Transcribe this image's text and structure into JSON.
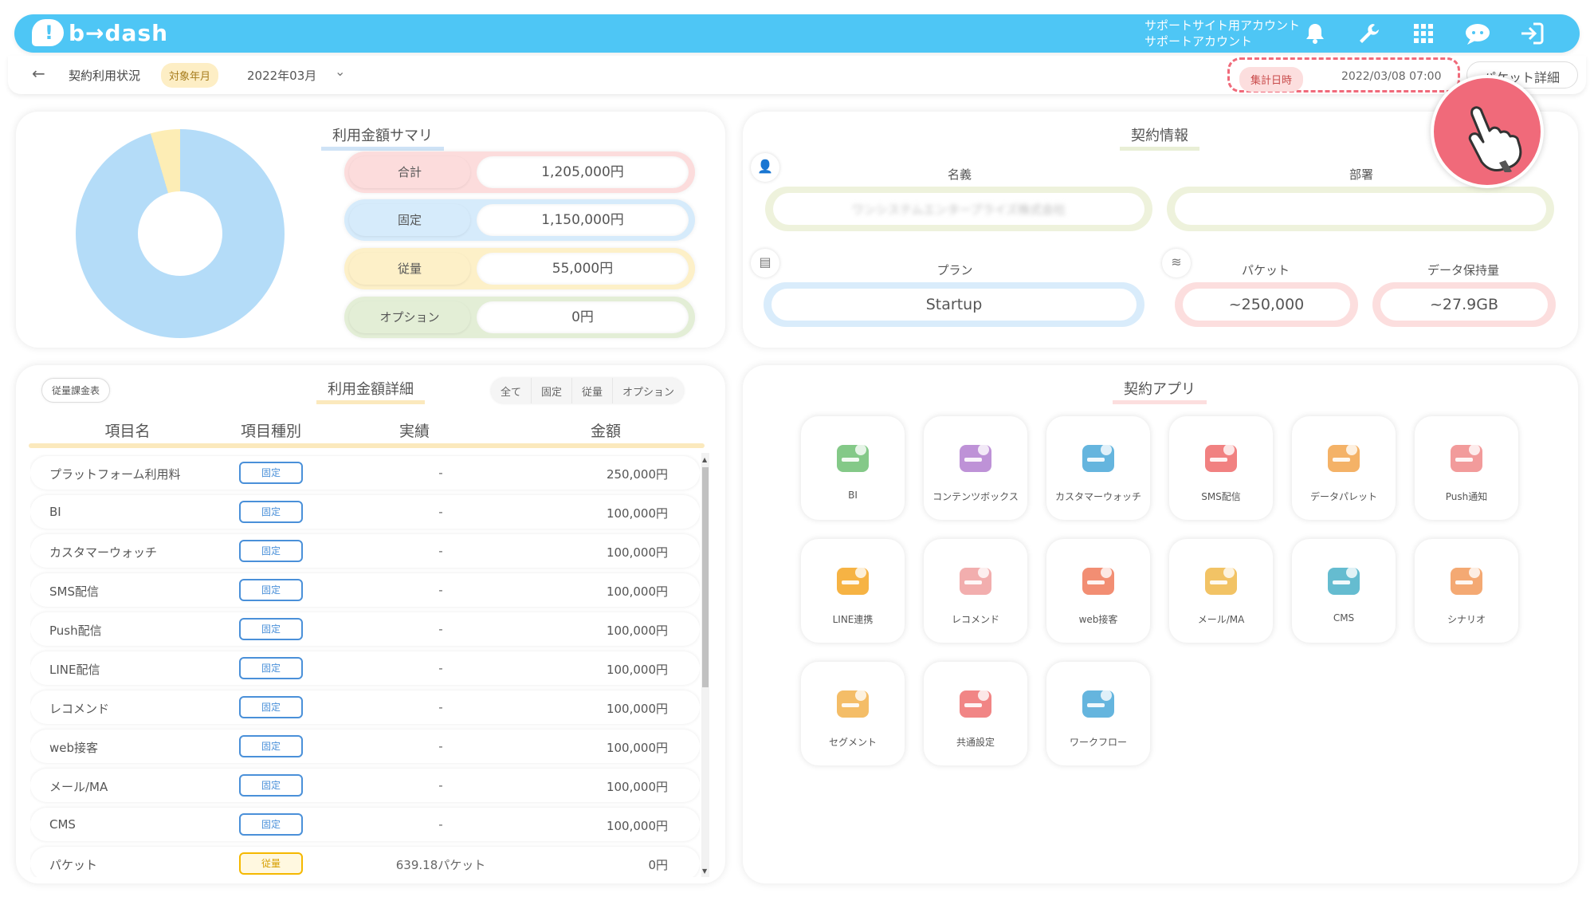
{
  "header": {
    "logo_text": "b→dash",
    "account_line1": "サポートサイト用アカウント",
    "account_line2": "サポートアカウント",
    "icons": [
      "bell-icon",
      "wrench-icon",
      "grid-icon",
      "chat-icon",
      "logout-icon"
    ]
  },
  "subbar": {
    "back_icon": "arrow-left-icon",
    "title": "契約利用状況",
    "period_tag": "対象年月",
    "month": "2022年03月",
    "aggregate_tag": "集計日時",
    "aggregate_time": "2022/03/08 07:00",
    "packet_detail": "パケット詳細"
  },
  "summary": {
    "title": "利用金額サマリ",
    "rows": [
      {
        "label": "合計",
        "value": "1,205,000円",
        "color": "#fcdcdc"
      },
      {
        "label": "固定",
        "value": "1,150,000円",
        "color": "#d6ebfb"
      },
      {
        "label": "従量",
        "value": "55,000円",
        "color": "#fdf0c8"
      },
      {
        "label": "オプション",
        "value": "0円",
        "color": "#e3eed6"
      }
    ],
    "donut_share": {
      "fixed": 1150000,
      "variable": 55000,
      "option": 0
    },
    "donut_colors": {
      "fixed": "#b4dcf8",
      "variable": "#fdedb5"
    }
  },
  "contract": {
    "title": "契約情報",
    "name_label": "名義",
    "name_value": "ワンシステムエンタープライズ株式会社",
    "dept_label": "部署",
    "dept_value": "",
    "plan_label": "プラン",
    "plan_value": "Startup",
    "packet_label": "パケット",
    "packet_value": "~250,000",
    "storage_label": "データ保持量",
    "storage_value": "~27.9GB"
  },
  "detail": {
    "title": "利用金額詳細",
    "chip": "従量課金表",
    "filters": [
      "全て",
      "固定",
      "従量",
      "オプション"
    ],
    "columns": [
      "項目名",
      "項目種別",
      "実績",
      "金額"
    ],
    "rows": [
      {
        "name": "プラットフォーム利用料",
        "type": "固定",
        "actual": "-",
        "amount": "250,000円"
      },
      {
        "name": "BI",
        "type": "固定",
        "actual": "-",
        "amount": "100,000円"
      },
      {
        "name": "カスタマーウォッチ",
        "type": "固定",
        "actual": "-",
        "amount": "100,000円"
      },
      {
        "name": "SMS配信",
        "type": "固定",
        "actual": "-",
        "amount": "100,000円"
      },
      {
        "name": "Push配信",
        "type": "固定",
        "actual": "-",
        "amount": "100,000円"
      },
      {
        "name": "LINE配信",
        "type": "固定",
        "actual": "-",
        "amount": "100,000円"
      },
      {
        "name": "レコメンド",
        "type": "固定",
        "actual": "-",
        "amount": "100,000円"
      },
      {
        "name": "web接客",
        "type": "固定",
        "actual": "-",
        "amount": "100,000円"
      },
      {
        "name": "メール/MA",
        "type": "固定",
        "actual": "-",
        "amount": "100,000円"
      },
      {
        "name": "CMS",
        "type": "固定",
        "actual": "-",
        "amount": "100,000円"
      },
      {
        "name": "パケット",
        "type": "従量",
        "actual": "639.18パケット",
        "amount": "0円"
      }
    ]
  },
  "apps": {
    "title": "契約アプリ",
    "items": [
      {
        "label": "BI",
        "icon": "bi-chart-icon"
      },
      {
        "label": "コンテンツボックス",
        "icon": "content-box-icon"
      },
      {
        "label": "カスタマーウォッチ",
        "icon": "magnifier-face-icon"
      },
      {
        "label": "SMS配信",
        "icon": "sms-bubble-icon"
      },
      {
        "label": "データパレット",
        "icon": "palette-icon"
      },
      {
        "label": "Push通知",
        "icon": "push-bell-icon"
      },
      {
        "label": "LINE連携",
        "icon": "line-bubble-icon"
      },
      {
        "label": "レコメンド",
        "icon": "recommend-chat-icon"
      },
      {
        "label": "web接客",
        "icon": "web-monitor-icon"
      },
      {
        "label": "メール/MA",
        "icon": "mail-envelope-icon"
      },
      {
        "label": "CMS",
        "icon": "cms-clipboard-icon"
      },
      {
        "label": "シナリオ",
        "icon": "scenario-flow-icon"
      },
      {
        "label": "セグメント",
        "icon": "segment-target-icon"
      },
      {
        "label": "共通設定",
        "icon": "settings-gear-icon"
      },
      {
        "label": "ワークフロー",
        "icon": "workflow-icon"
      }
    ]
  }
}
